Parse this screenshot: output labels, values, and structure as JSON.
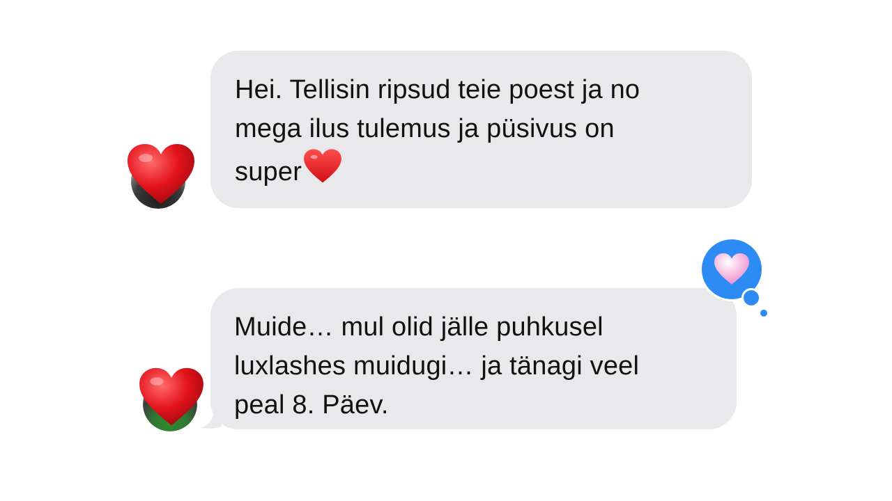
{
  "messages": [
    {
      "sender": "other",
      "lines": [
        "Hei. Tellisin ripsud teie poest ja no",
        "mega ilus tulemus ja püsivus on",
        "super"
      ],
      "trailing_emoji": "red-heart-icon"
    },
    {
      "sender": "other",
      "lines": [
        "Muide… mul olid jälle puhkusel",
        "luxlashes muidugi… ja tänagi veel",
        "peal 8. Päev."
      ],
      "reaction": "pink-heart-icon"
    }
  ],
  "colors": {
    "bubble": "#e9e9eb",
    "text": "#111111",
    "reaction_bubble": "#2c8cf4",
    "heart_red": "#e3131b",
    "heart_pink": "#f7a6d8"
  }
}
